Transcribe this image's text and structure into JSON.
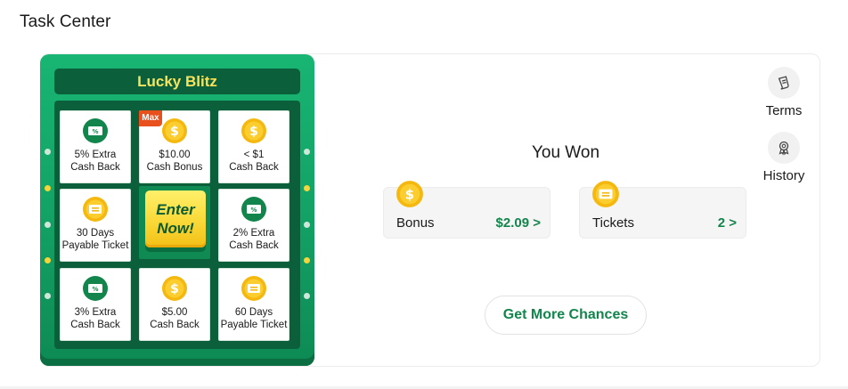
{
  "page": {
    "title": "Task Center"
  },
  "board": {
    "title": "Lucky Blitz",
    "max_badge": "Max",
    "enter_line1": "Enter",
    "enter_line2": "Now!",
    "tiles": [
      {
        "line1": "5% Extra",
        "line2": "Cash Back",
        "icon": "percent-ticket-icon"
      },
      {
        "line1": "$10.00",
        "line2": "Cash Bonus",
        "icon": "dollar-coin-icon"
      },
      {
        "line1": "< $1",
        "line2": "Cash Back",
        "icon": "dollar-coin-icon"
      },
      {
        "line1": "30 Days",
        "line2": "Payable Ticket",
        "icon": "ticket-coin-icon"
      },
      {
        "line1": "2% Extra",
        "line2": "Cash Back",
        "icon": "percent-ticket-icon"
      },
      {
        "line1": "3% Extra",
        "line2": "Cash Back",
        "icon": "percent-ticket-icon"
      },
      {
        "line1": "$5.00",
        "line2": "Cash Back",
        "icon": "dollar-coin-icon"
      },
      {
        "line1": "60 Days",
        "line2": "Payable Ticket",
        "icon": "ticket-coin-icon"
      }
    ]
  },
  "side": {
    "terms_label": "Terms",
    "history_label": "History"
  },
  "won": {
    "title": "You Won",
    "bonus_label": "Bonus",
    "bonus_value": "$2.09 >",
    "tickets_label": "Tickets",
    "tickets_value": "2 >"
  },
  "cta": {
    "label": "Get More Chances"
  },
  "colors": {
    "brand_green": "#12854c",
    "board_green": "#13a064",
    "board_dark": "#0b5f3a",
    "title_yellow": "#f8e45c",
    "coin_gold": "#f5b80f",
    "max_red": "#e8501d"
  }
}
